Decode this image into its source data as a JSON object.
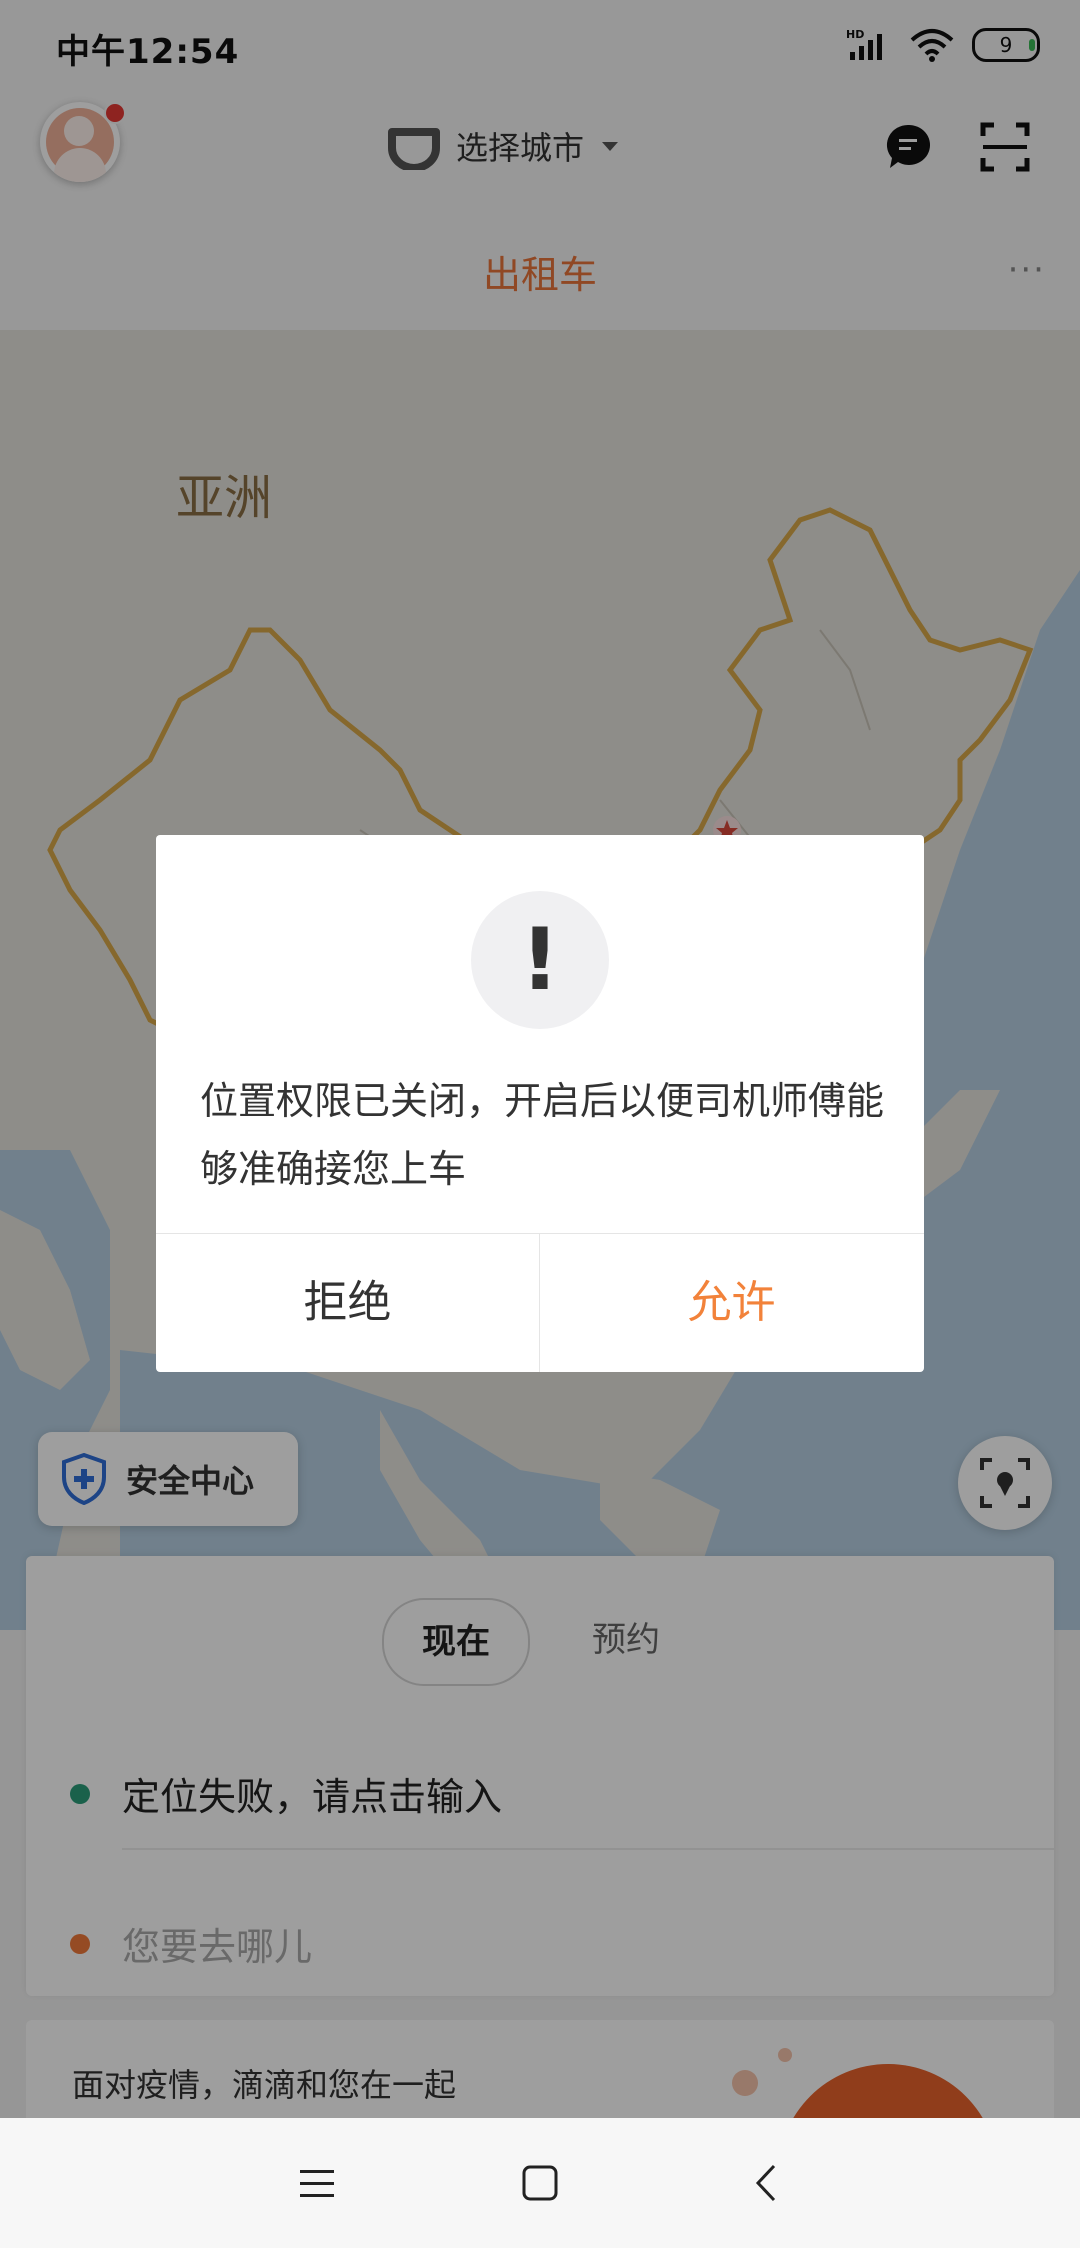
{
  "status_bar": {
    "time": "中午12:54",
    "battery": "9",
    "network_badge": "HD"
  },
  "header": {
    "city_select_label": "选择城市"
  },
  "tabs": {
    "active": "出租车",
    "more": "···"
  },
  "map": {
    "region_label": "亚洲"
  },
  "safety": {
    "label": "安全中心"
  },
  "ride_card": {
    "time_options": [
      "现在",
      "预约"
    ],
    "pickup_text": "定位失败，请点击输入",
    "destination_placeholder": "您要去哪儿",
    "pickup_dot_color": "#2a9d7a",
    "destination_dot_color": "#f07a3a"
  },
  "banner": {
    "text": "面对疫情，滴滴和您在一起"
  },
  "dialog": {
    "message": "位置权限已关闭，开启后以便司机师傅能够准确接您上车",
    "deny_label": "拒绝",
    "allow_label": "允许",
    "accent_color": "#f2823a"
  },
  "colors": {
    "brand_orange": "#e8743b",
    "sea": "#b6cfe2",
    "land": "#e6e4de",
    "border": "#d8a94a"
  }
}
